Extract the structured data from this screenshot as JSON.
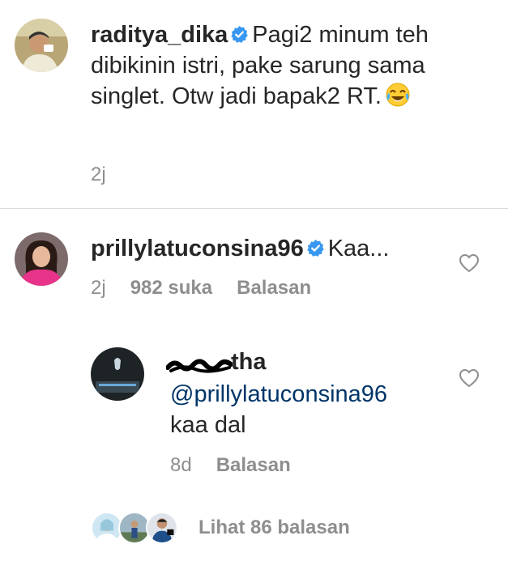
{
  "caption": {
    "username": "raditya_dika",
    "text": "Pagi2 minum teh dibikinin istri, pake sarung sama singlet. Otw jadi bapak2 RT.",
    "emoji": "face-with-tears-of-joy",
    "time": "2j"
  },
  "comment": {
    "username": "prillylatuconsina96",
    "text": "Kaa...",
    "time": "2j",
    "likes": "982 suka",
    "reply_label": "Balasan"
  },
  "reply": {
    "username_visible": "tha",
    "mention": "@prillylatuconsina96",
    "text": "kaa dal",
    "time": "8d",
    "reply_label": "Balasan"
  },
  "view_more": {
    "label": "Lihat 86 balasan"
  },
  "colors": {
    "text": "#262626",
    "muted": "#8e8e8e",
    "verified": "#3897f0",
    "mention": "#003569",
    "divider": "#dbdbdb"
  }
}
